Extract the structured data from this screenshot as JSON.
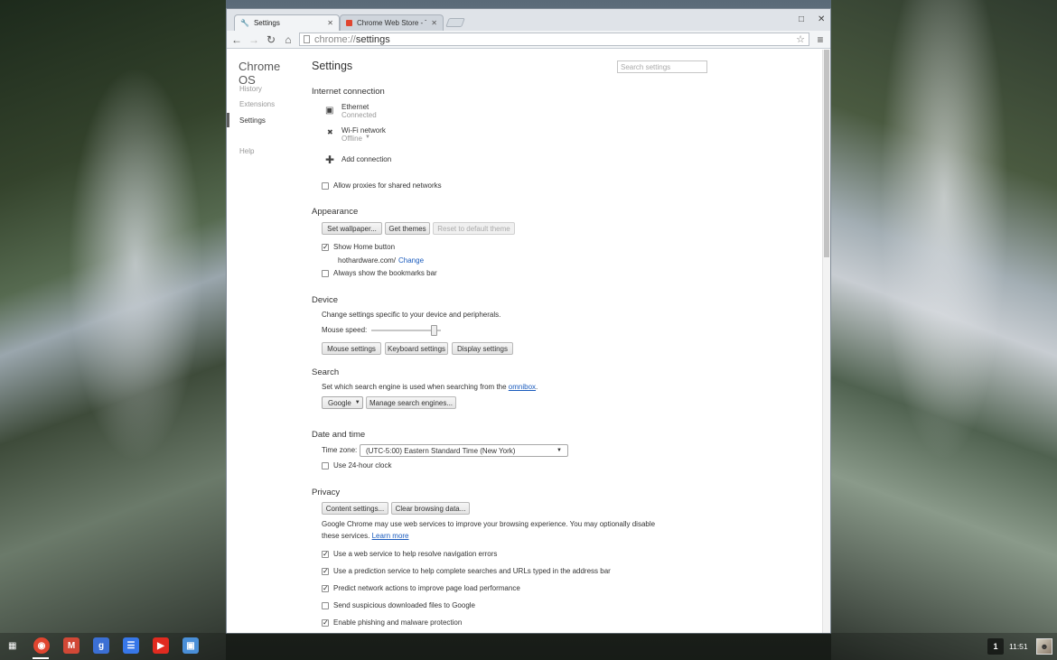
{
  "tabs": [
    {
      "title": "Settings",
      "icon": "wrench-icon",
      "active": true
    },
    {
      "title": "Chrome Web Store - The",
      "icon": "webstore-icon",
      "active": false
    }
  ],
  "toolbar": {
    "url_scheme": "chrome://",
    "url_host": "settings"
  },
  "sidebar": {
    "brand": "Chrome OS",
    "items": [
      {
        "label": "History"
      },
      {
        "label": "Extensions"
      },
      {
        "label": "Settings"
      },
      {
        "label": "Help"
      }
    ]
  },
  "page": {
    "title": "Settings",
    "search_placeholder": "Search settings"
  },
  "internet": {
    "heading": "Internet connection",
    "ethernet_name": "Ethernet",
    "ethernet_status": "Connected",
    "wifi_name": "Wi-Fi network",
    "wifi_status": "Offline",
    "add_connection": "Add connection",
    "proxy_label": "Allow proxies for shared networks"
  },
  "appearance": {
    "heading": "Appearance",
    "set_wallpaper": "Set wallpaper...",
    "get_themes": "Get themes",
    "reset_theme": "Reset to default theme",
    "show_home": "Show Home button",
    "home_url": "hothardware.com/",
    "change": "Change",
    "bookmarks_bar": "Always show the bookmarks bar"
  },
  "device": {
    "heading": "Device",
    "description": "Change settings specific to your device and peripherals.",
    "mouse_speed": "Mouse speed:",
    "mouse_speed_value": 0.9,
    "mouse_settings": "Mouse settings",
    "keyboard_settings": "Keyboard settings",
    "display_settings": "Display settings"
  },
  "search": {
    "heading": "Search",
    "description_prefix": "Set which search engine is used when searching from the",
    "omnibox_link": "omnibox",
    "description_suffix": ".",
    "engine": "Google",
    "manage": "Manage search engines..."
  },
  "datetime": {
    "heading": "Date and time",
    "timezone_label": "Time zone:",
    "timezone_value": "(UTC-5:00) Eastern Standard Time (New York)",
    "clock24": "Use 24-hour clock"
  },
  "privacy": {
    "heading": "Privacy",
    "content_settings": "Content settings...",
    "clear_browsing": "Clear browsing data...",
    "desc_line1": "Google Chrome may use web services to improve your browsing experience. You may optionally disable",
    "desc_line2": "these services.",
    "learn_more": "Learn more",
    "options": [
      {
        "label": "Use a web service to help resolve navigation errors",
        "checked": true
      },
      {
        "label": "Use a prediction service to help complete searches and URLs typed in the address bar",
        "checked": true
      },
      {
        "label": "Predict network actions to improve page load performance",
        "checked": true
      },
      {
        "label": "Send suspicious downloaded files to Google",
        "checked": false
      },
      {
        "label": "Enable phishing and malware protection",
        "checked": true
      }
    ]
  },
  "shelf": {
    "apps": [
      {
        "name": "chrome-icon",
        "color": "#e0452f"
      },
      {
        "name": "gmail-icon",
        "color": "#d14836"
      },
      {
        "name": "google-search-icon",
        "color": "#3b6fd4"
      },
      {
        "name": "docs-icon",
        "color": "#3777e8"
      },
      {
        "name": "youtube-icon",
        "color": "#e02b20"
      },
      {
        "name": "files-icon",
        "color": "#4a8fd8"
      }
    ],
    "notification_count": "1",
    "clock": "11:51"
  }
}
